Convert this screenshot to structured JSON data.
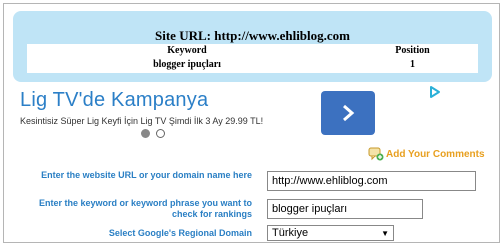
{
  "result": {
    "title": "Site URL: http://www.ehliblog.com",
    "headers": {
      "keyword": "Keyword",
      "position": "Position"
    },
    "row": {
      "keyword": "blogger ipuçları",
      "position": "1"
    }
  },
  "ad": {
    "title": "Lig TV'de Kampanya",
    "description": "Kesintisiz Süper Lig Keyfi İçin Lig TV Şimdi İlk 3 Ay 29.99 TL!",
    "button_icon": "chevron-right-icon",
    "adchoices_icon": "adchoices-icon"
  },
  "comments": {
    "label": "Add Your Comments",
    "icon": "comment-add-icon"
  },
  "form": {
    "url_label": "Enter the website URL or your domain name here",
    "url_value": "http://www.ehliblog.com",
    "keyword_label": "Enter the keyword or keyword phrase you want to check for rankings",
    "keyword_value": "blogger ipuçları",
    "domain_label": "Select Google's Regional Domain",
    "domain_value": "Türkiye"
  },
  "colors": {
    "panel_bg": "#bfe4f6",
    "ad_title": "#2b7fc7",
    "ad_button": "#3c71c0",
    "label_blue": "#2a7fc4",
    "comments_orange": "#e8a020"
  }
}
